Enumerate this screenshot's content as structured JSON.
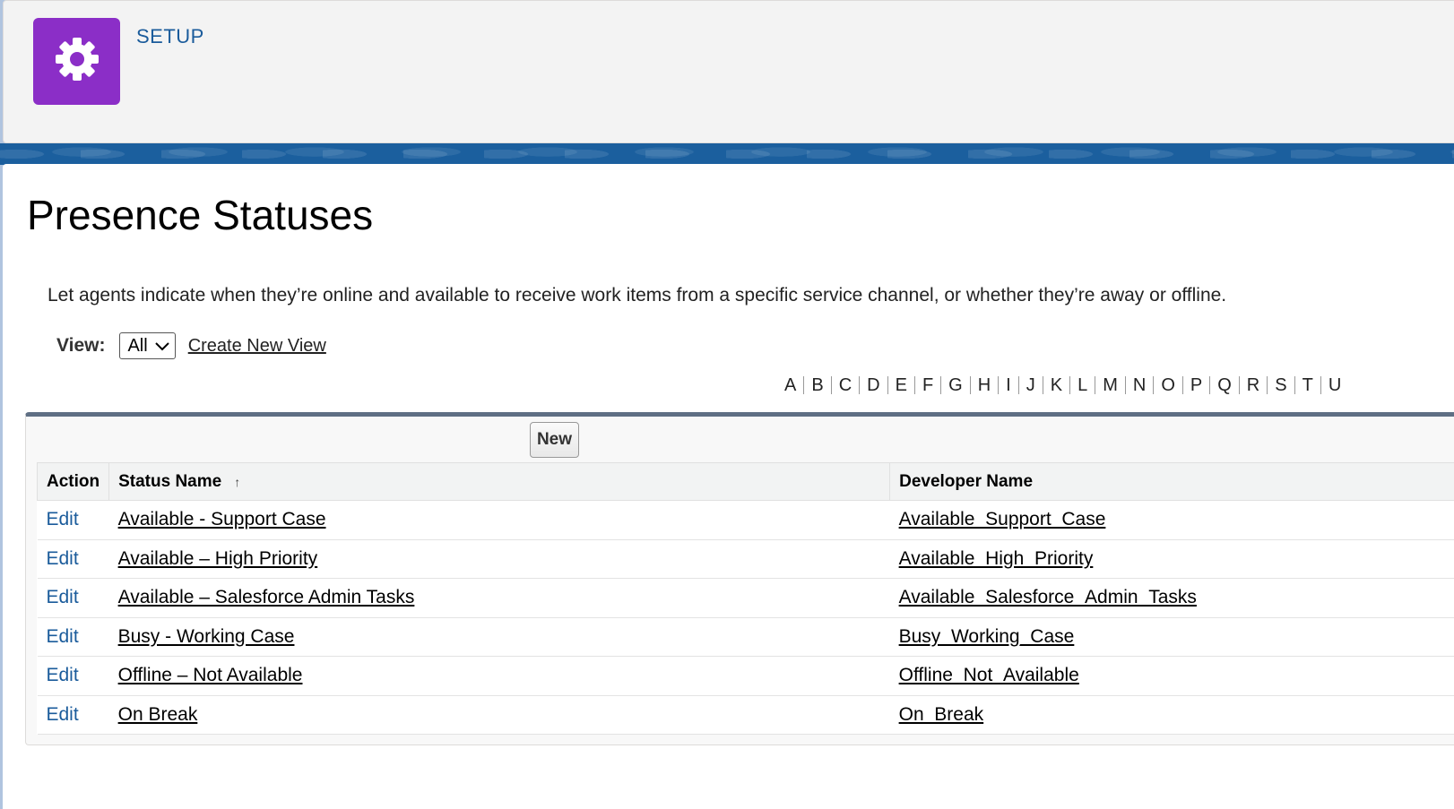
{
  "header": {
    "app_label": "SETUP",
    "icon": "gear-icon",
    "icon_color": "#8b2ec7"
  },
  "page": {
    "title": "Presence Statuses",
    "description": "Let agents indicate when they’re online and available to receive work items from a specific service channel, or whether they’re away or offline."
  },
  "view_controls": {
    "view_label": "View:",
    "selected_view": "All",
    "create_new_view": "Create New View"
  },
  "alphabet": [
    "A",
    "B",
    "C",
    "D",
    "E",
    "F",
    "G",
    "H",
    "I",
    "J",
    "K",
    "L",
    "M",
    "N",
    "O",
    "P",
    "Q",
    "R",
    "S",
    "T",
    "U"
  ],
  "toolbar": {
    "new_label": "New"
  },
  "table": {
    "columns": {
      "action": "Action",
      "status_name": "Status Name",
      "developer_name": "Developer Name"
    },
    "sort_indicator": "↑",
    "rows": [
      {
        "action": "Edit",
        "status_name": "Available - Support Case",
        "developer_name": "Available_Support_Case"
      },
      {
        "action": "Edit",
        "status_name": "Available – High Priority",
        "developer_name": "Available_High_Priority"
      },
      {
        "action": "Edit",
        "status_name": "Available – Salesforce Admin Tasks",
        "developer_name": "Available_Salesforce_Admin_Tasks"
      },
      {
        "action": "Edit",
        "status_name": "Busy - Working Case",
        "developer_name": "Busy_Working_Case"
      },
      {
        "action": "Edit",
        "status_name": "Offline – Not Available",
        "developer_name": "Offline_Not_Available"
      },
      {
        "action": "Edit",
        "status_name": "On Break",
        "developer_name": "On_Break"
      }
    ]
  },
  "colors": {
    "link_blue": "#1a5b9b",
    "band_blue": "#1b5f9e",
    "panel_border": "#5f6f84"
  }
}
